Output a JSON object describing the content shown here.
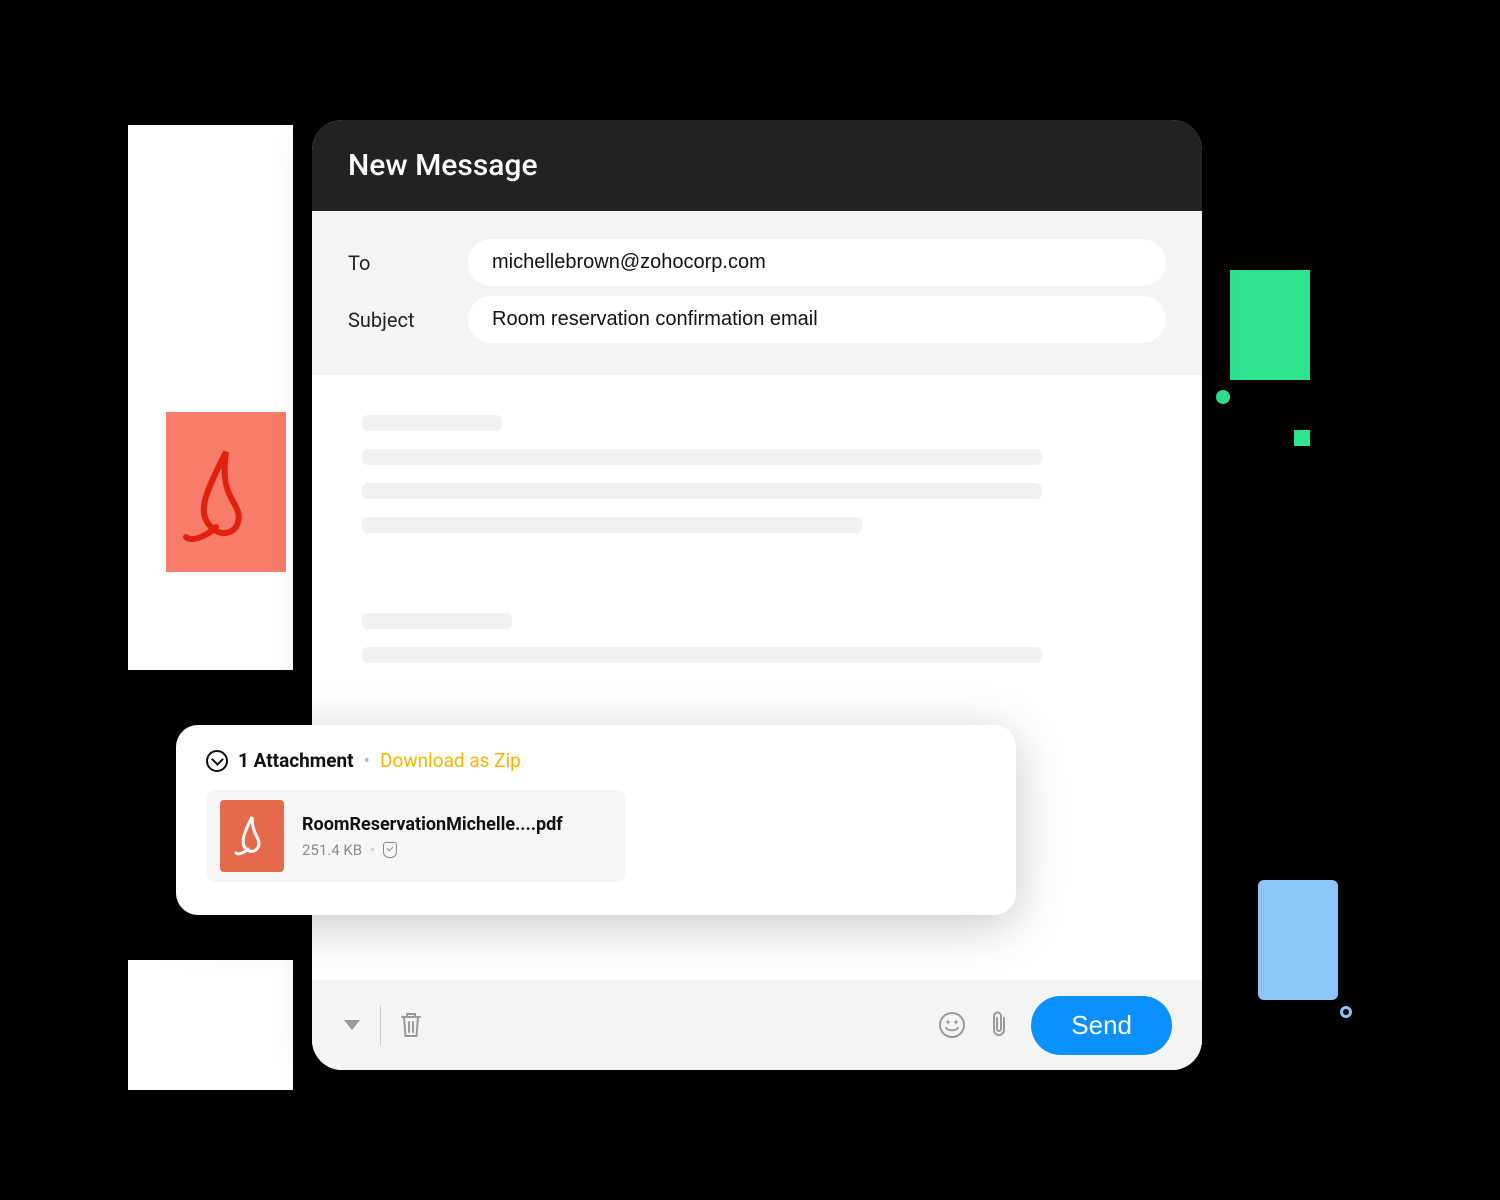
{
  "header": {
    "title": "New Message"
  },
  "fields": {
    "to_label": "To",
    "to_value": "michellebrown@zohocorp.com",
    "subject_label": "Subject",
    "subject_value": "Room reservation confirmation email"
  },
  "attachment": {
    "count_label": "1 Attachment",
    "download_zip_label": "Download as Zip",
    "file_name": "RoomReservationMichelle....pdf",
    "file_size": "251.4 KB"
  },
  "toolbar": {
    "send_label": "Send"
  },
  "icons": {
    "pdf": "pdf-icon",
    "chevron_down": "chevron-down-icon",
    "trash": "trash-icon",
    "emoji": "emoji-icon",
    "attachment": "paperclip-icon",
    "more": "more-icon"
  }
}
